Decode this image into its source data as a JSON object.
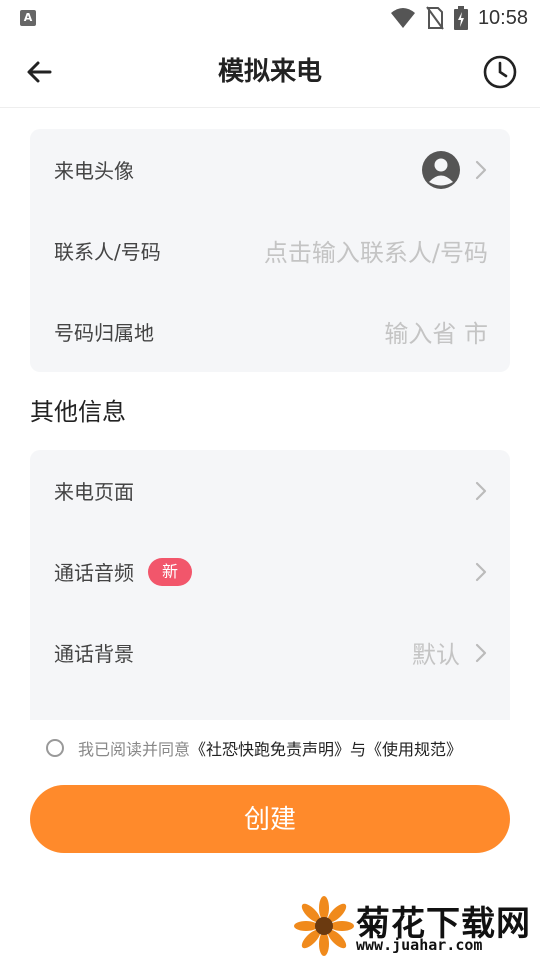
{
  "status_bar": {
    "time": "10:58",
    "notif_letter": "A"
  },
  "header": {
    "title": "模拟来电"
  },
  "contact_card": {
    "avatar_label": "来电头像",
    "contact_label": "联系人/号码",
    "contact_placeholder": "点击输入联系人/号码",
    "location_label": "号码归属地",
    "location_placeholder": "输入省 市"
  },
  "other_info": {
    "section_title": "其他信息",
    "call_page_label": "来电页面",
    "call_audio_label": "通话音频",
    "call_audio_badge": "新",
    "call_bg_label": "通话背景",
    "call_bg_value": "默认"
  },
  "agreement": {
    "prefix": "我已阅读并同意",
    "disclaimer": "《社恐快跑免责声明》",
    "joiner": "与",
    "rules": "《使用规范》"
  },
  "actions": {
    "create_label": "创建"
  },
  "watermark": {
    "title": "菊花下载网",
    "url": "www.juahar.com"
  },
  "colors": {
    "accent": "#ff8a2b",
    "badge": "#f2566b",
    "card_bg": "#f5f6f8"
  }
}
